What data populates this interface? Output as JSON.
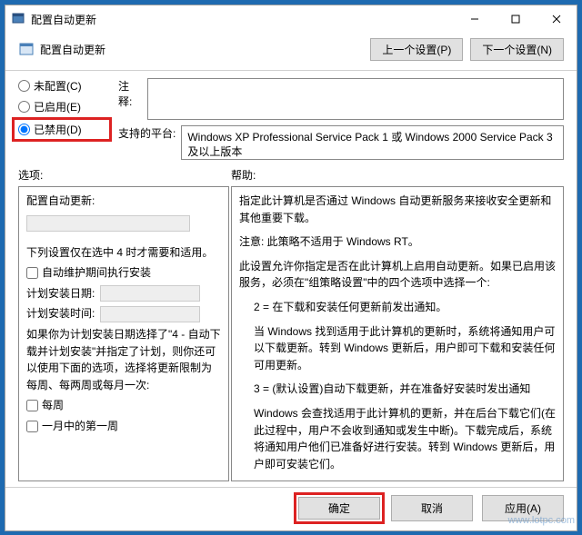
{
  "window": {
    "title": "配置自动更新"
  },
  "header": {
    "title": "配置自动更新",
    "prev": "上一个设置(P)",
    "next": "下一个设置(N)"
  },
  "radios": {
    "not_configured": "未配置(C)",
    "enabled": "已启用(E)",
    "disabled": "已禁用(D)"
  },
  "comment_label": "注释:",
  "platform_label": "支持的平台:",
  "platform_text": "Windows XP Professional Service Pack 1 或 Windows 2000 Service Pack 3 及以上版本",
  "columns": {
    "options": "选项:",
    "help": "帮助:"
  },
  "options": {
    "heading": "配置自动更新:",
    "note": "下列设置仅在选中 4 时才需要和适用。",
    "maint_check": "自动维护期间执行安装",
    "install_day_label": "计划安装日期:",
    "install_time_label": "计划安装时间:",
    "sched_note": "如果你为计划安装日期选择了\"4 - 自动下载并计划安装\"并指定了计划，则你还可以使用下面的选项，选择将更新限制为每周、每两周或每月一次:",
    "weekly_check": "每周",
    "first_week_check": "一月中的第一周"
  },
  "help": {
    "p1": "指定此计算机是否通过 Windows 自动更新服务来接收安全更新和其他重要下载。",
    "p2": "注意: 此策略不适用于 Windows RT。",
    "p3": "此设置允许你指定是否在此计算机上启用自动更新。如果已启用该服务，必须在\"组策略设置\"中的四个选项中选择一个:",
    "p4": "2 = 在下载和安装任何更新前发出通知。",
    "p5": "当 Windows 找到适用于此计算机的更新时，系统将通知用户可以下载更新。转到 Windows 更新后，用户即可下载和安装任何可用更新。",
    "p6": "3 = (默认设置)自动下载更新，并在准备好安装时发出通知",
    "p7": "Windows 会查找适用于此计算机的更新，并在后台下载它们(在此过程中，用户不会收到通知或发生中断)。下载完成后，系统将通知用户他们已准备好进行安装。转到 Windows 更新后，用户即可安装它们。"
  },
  "footer": {
    "ok": "确定",
    "cancel": "取消",
    "apply": "应用(A)"
  },
  "watermark": "www.lotpc.com"
}
